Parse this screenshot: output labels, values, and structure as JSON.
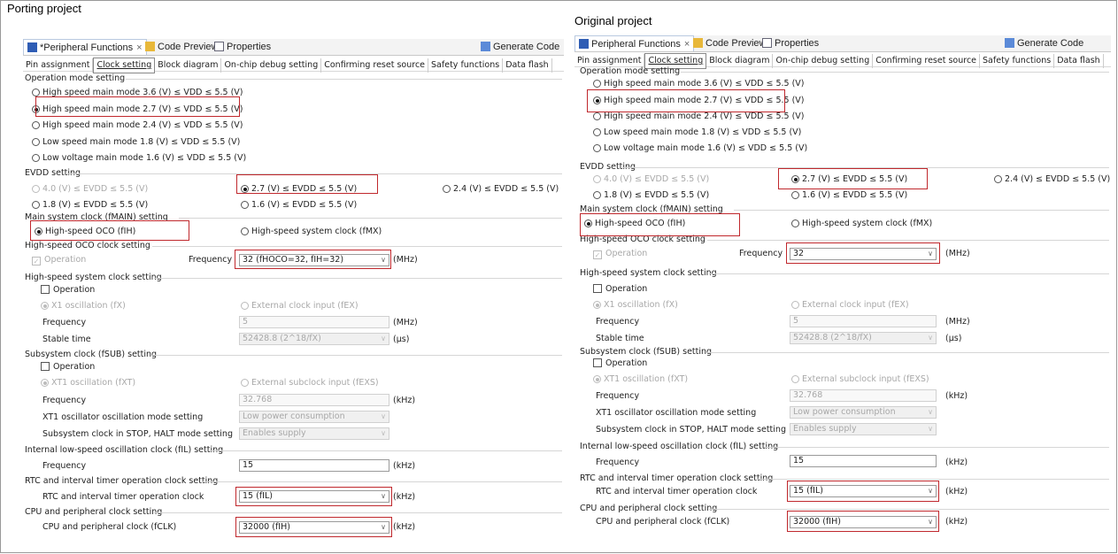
{
  "left_title": "Porting project",
  "right_title": "Original project",
  "tabs": {
    "pf_left": "*Peripheral Functions",
    "pf_right": "Peripheral Functions",
    "close": "×",
    "code_preview": "Code Preview",
    "properties": "Properties",
    "generate": "Generate Code"
  },
  "subtabs": [
    "Pin assignment",
    "Clock setting",
    "Block diagram",
    "On-chip debug setting",
    "Confirming reset source",
    "Safety functions",
    "Data flash"
  ],
  "groups": {
    "op": "Operation mode setting",
    "evdd": "EVDD setting",
    "main": "Main system clock (fMAIN) setting",
    "hocoset": "High-speed OCO clock setting",
    "hs": "High-speed system clock setting",
    "sub": "Subsystem clock (fSUB) setting",
    "il": "Internal low-speed oscillation clock (fIL) setting",
    "rtc": "RTC and interval timer operation clock setting",
    "cpu": "CPU and peripheral clock setting"
  },
  "op_modes": [
    "High speed main mode 3.6 (V) ≤ VDD ≤ 5.5 (V)",
    "High speed main mode 2.7 (V) ≤ VDD ≤ 5.5 (V)",
    "High speed main mode 2.4 (V) ≤ VDD ≤ 5.5 (V)",
    "Low speed main mode 1.8 (V) ≤ VDD ≤ 5.5 (V)",
    "Low voltage main mode 1.6 (V) ≤ VDD ≤ 5.5 (V)"
  ],
  "evdd": {
    "o40": "4.0 (V) ≤ EVDD ≤ 5.5 (V)",
    "o27": "2.7 (V) ≤ EVDD ≤ 5.5 (V)",
    "o24": "2.4 (V) ≤ EVDD ≤ 5.5 (V)",
    "o18": "1.8 (V) ≤ EVDD ≤ 5.5 (V)",
    "o16": "1.6 (V) ≤ EVDD ≤ 5.5 (V)"
  },
  "main": {
    "hoco": "High-speed OCO (fIH)",
    "hsys": "High-speed system clock (fMX)"
  },
  "labels": {
    "operation": "Operation",
    "frequency": "Frequency",
    "x1": "X1 oscillation (fX)",
    "ext": "External clock input (fEX)",
    "stable": "Stable time",
    "xt1": "XT1 oscillation (fXT)",
    "extsub": "External subclock input (fEXS)",
    "xt1mode": "XT1 oscillator oscillation mode setting",
    "substop": "Subsystem clock in STOP, HALT mode setting",
    "rtcclk": "RTC and interval timer operation clock",
    "cpuclk": "CPU and peripheral clock (fCLK)"
  },
  "units": {
    "mhz": "(MHz)",
    "us": "(μs)",
    "khz": "(kHz)"
  },
  "values": {
    "hoco_left": "32 (fHOCO=32, fIH=32)",
    "hoco_right": "32",
    "hs_freq": "5",
    "hs_stable": "52428.8 (2^18/fX)",
    "sub_freq": "32.768",
    "xt1mode": "Low power consumption",
    "substop": "Enables supply",
    "il_freq": "15",
    "rtc": "15 (fIL)",
    "cpu": "32000 (fIH)"
  },
  "colors": {
    "highlight": "#c0282d",
    "active_tab_icon": "#2f5db5"
  }
}
